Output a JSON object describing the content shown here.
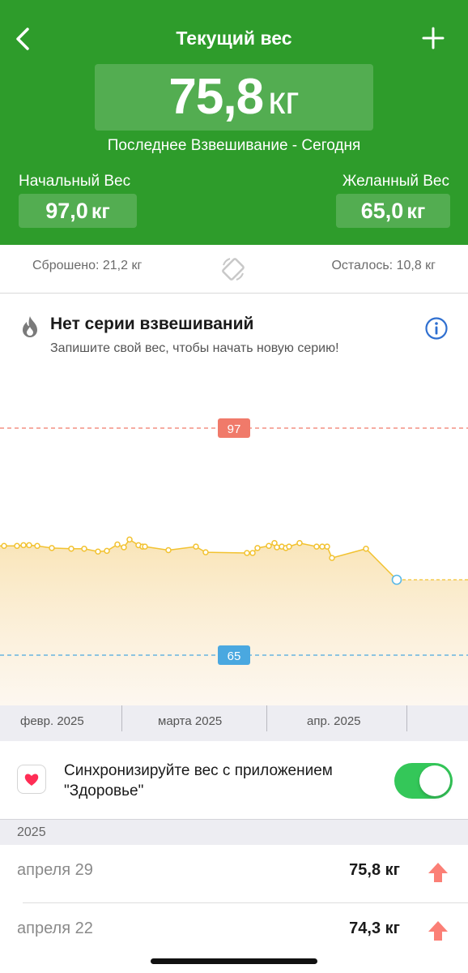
{
  "header": {
    "title": "Текущий вес",
    "current_weight": "75,8",
    "current_unit": "кг",
    "last_weigh": "Последнее Взвешивание - Сегодня",
    "start_label": "Начальный Вес",
    "start_value": "97,0",
    "start_unit": "кг",
    "goal_label": "Желанный Вес",
    "goal_value": "65,0",
    "goal_unit": "кг",
    "background_color": "#2e9c2b"
  },
  "stats": {
    "lost": "Сброшено: 21,2 кг",
    "remaining": "Осталось: 10,8 кг"
  },
  "streak": {
    "title": "Нет серии взвешиваний",
    "subtitle": "Запишите свой вес, чтобы начать новую серию!"
  },
  "chart_data": {
    "type": "line",
    "series": [
      {
        "values": [
          80.4,
          80.4,
          80.5,
          80.5,
          80.4,
          80.1,
          80.0,
          80.0,
          79.6,
          79.7,
          80.6,
          80.2,
          81.3,
          80.5,
          80.3,
          80.3,
          79.8,
          80.3,
          79.5,
          79.4,
          79.4,
          80.1,
          80.4,
          80.8,
          80.2,
          80.3,
          80.1,
          80.3,
          80.8,
          80.3,
          80.3,
          80.3,
          78.7,
          80.0,
          79.9,
          79.6,
          78.2,
          78.8,
          79.6
        ]
      }
    ],
    "current_point": 75.8,
    "reference_lines": [
      {
        "value": 97,
        "label": "97",
        "color": "#f07a6a"
      },
      {
        "value": 65,
        "label": "65",
        "color": "#4aa8e0"
      }
    ],
    "x_tick_labels": [
      "февр. 2025",
      "марта 2025",
      "апр. 2025"
    ],
    "line_color": "#f2c230"
  },
  "sync": {
    "label": "Синхронизируйте вес с приложением \"Здоровье\"",
    "enabled": true,
    "toggle_color": "#34c759"
  },
  "history": {
    "year": "2025",
    "entries": [
      {
        "date": "апреля 29",
        "value": "75,8 кг",
        "trend": "up"
      },
      {
        "date": "апреля 22",
        "value": "74,3 кг",
        "trend": "up"
      }
    ]
  }
}
